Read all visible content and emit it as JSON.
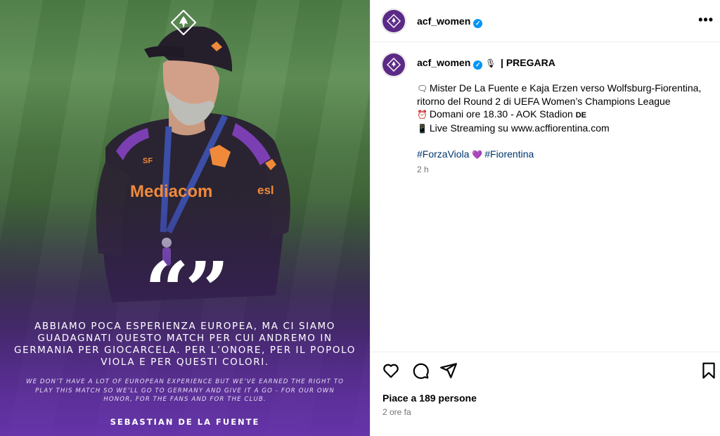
{
  "account": {
    "username": "acf_women",
    "caption_tag": "| PREGARA"
  },
  "caption": {
    "line1": "Mister De La Fuente e Kaja Erzen verso Wolfsburg-Fiorentina,",
    "line2": "ritorno del Round 2 di UEFA Women’s Champions League",
    "line3": "Domani ore 18.30 - AOK Stadion",
    "line3_flag": "DE",
    "line4": "Live Streaming su www.acffiorentina.com",
    "hashtag1": "#ForzaViola",
    "hashtag2": "#Fiorentina",
    "time_ago": "2 h"
  },
  "image": {
    "quote_it": "Abbiamo poca esperienza europea, ma ci siamo guadagnati questo match per cui andremo in Germania per giocarcela. Per l’onore, per il popolo viola e per questi colori.",
    "quote_en": "We don’t have a lot of European experience but we’ve earned the right to play this match so we’ll go to Germany and give it a go - for our own honor, for the fans and for the club.",
    "quote_author": "SEBASTIAN DE LA FUENTE",
    "quote_marks": "“”",
    "shirt_sponsor": "Mediacom",
    "shirt_initials": "SF"
  },
  "stats": {
    "likes": "Piace a 189 persone",
    "date": "2 ore fa"
  },
  "colors": {
    "brand_purple": "#5b2a86",
    "link_blue": "#00376b",
    "verified_blue": "#0095f6"
  }
}
